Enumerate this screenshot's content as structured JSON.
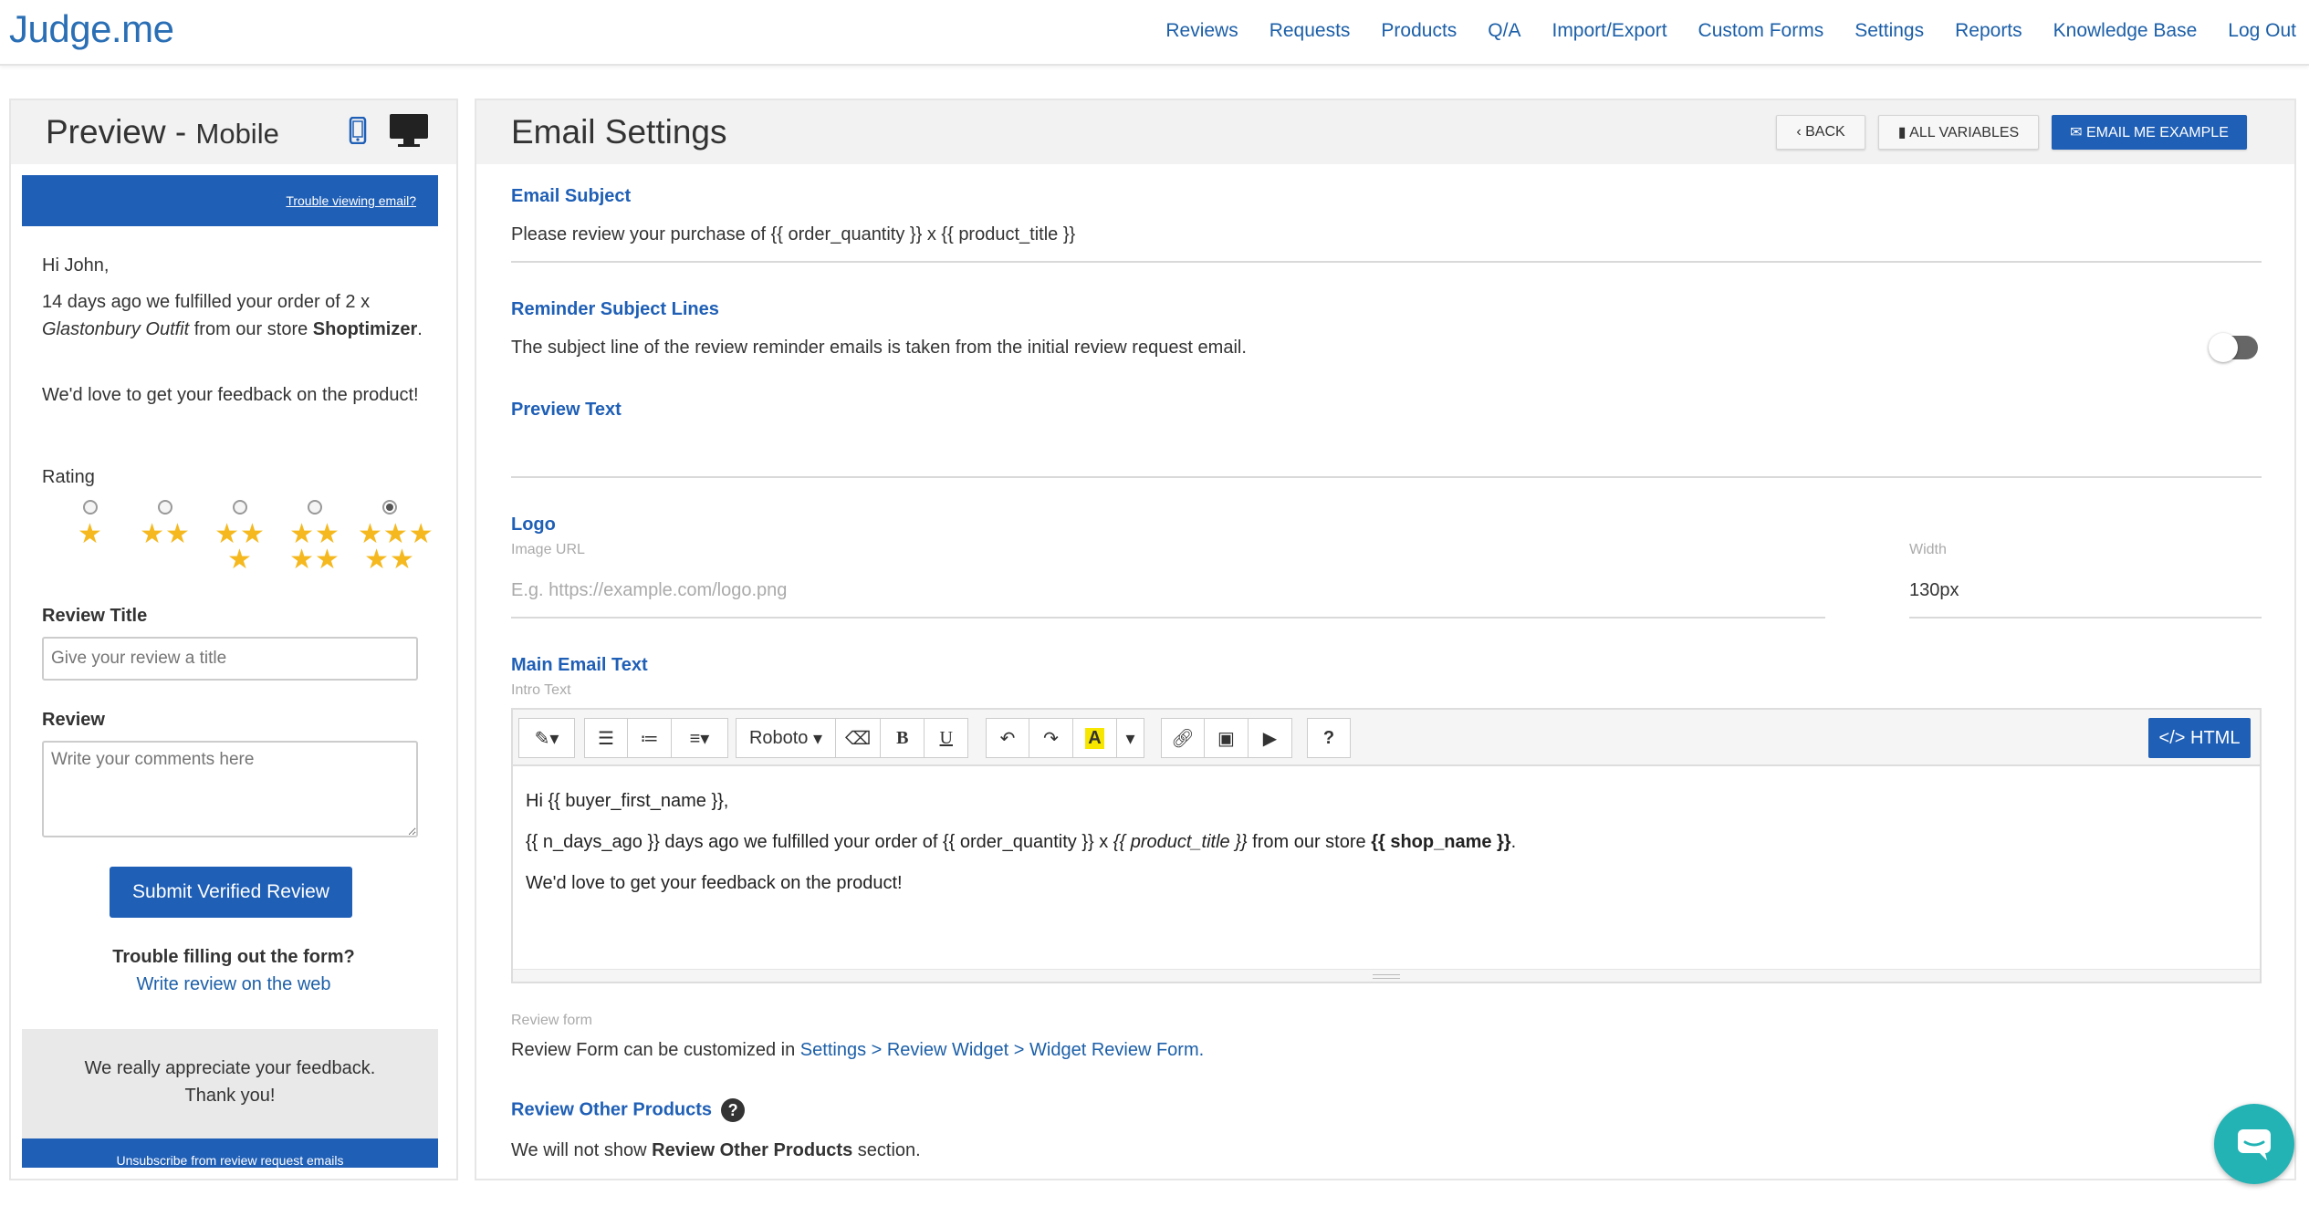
{
  "nav": {
    "logo": "Judge.me",
    "links": [
      "Reviews",
      "Requests",
      "Products",
      "Q/A",
      "Import/Export",
      "Custom Forms",
      "Settings",
      "Reports",
      "Knowledge Base",
      "Log Out"
    ]
  },
  "preview": {
    "title": "Preview",
    "separator": " - ",
    "mode": "Mobile",
    "trouble_viewing": "Trouble viewing email?",
    "greeting": "Hi John,",
    "p1_prefix": "14 days ago we fulfilled your order of 2 x ",
    "p1_product": "Glastonbury Outfit",
    "p1_mid": " from our store ",
    "p1_store": "Shoptimizer",
    "p1_suffix": ".",
    "p2": "We'd love to get your feedback on the product!",
    "rating_label": "Rating",
    "rating_selected": 5,
    "review_title_label": "Review Title",
    "review_title_placeholder": "Give your review a title",
    "review_label": "Review",
    "review_placeholder": "Write your comments here",
    "submit_label": "Submit Verified Review",
    "trouble_form": "Trouble filling out the form?",
    "write_web": "Write review on the web",
    "thanks_line1": "We really appreciate your feedback.",
    "thanks_line2": "Thank you!",
    "unsubscribe": "Unsubscribe from review request emails"
  },
  "settings": {
    "title": "Email Settings",
    "back_label": "BACK",
    "vars_label": "ALL VARIABLES",
    "example_label": "EMAIL ME EXAMPLE",
    "email_subject_title": "Email Subject",
    "email_subject_value": "Please review your purchase of {{ order_quantity }} x {{ product_title }}",
    "reminder_title": "Reminder Subject Lines",
    "reminder_text": "The subject line of the review reminder emails is taken from the initial review request email.",
    "reminder_toggle_on": false,
    "preview_text_title": "Preview Text",
    "preview_text_value": "",
    "logo_title": "Logo",
    "image_url_label": "Image URL",
    "image_url_placeholder": "E.g. https://example.com/logo.png",
    "width_label": "Width",
    "width_value": "130px",
    "main_text_title": "Main Email Text",
    "intro_label": "Intro Text",
    "font_label": "Roboto",
    "html_label": "HTML",
    "editor_line1": "Hi {{ buyer_first_name }},",
    "editor_line2_a": "{{ n_days_ago }} days ago we fulfilled your order of {{ order_quantity }} x ",
    "editor_line2_b": "{{ product_title }}",
    "editor_line2_c": " from our store ",
    "editor_line2_d": "{{ shop_name }}",
    "editor_line2_e": ".",
    "editor_line3": "We'd love to get your feedback on the product!",
    "review_form_label": "Review form",
    "review_form_prefix": "Review Form can be customized in ",
    "review_form_link": "Settings > Review Widget > Widget Review Form.",
    "other_products_title": "Review Other Products",
    "other_products_help": "?",
    "other_products_prefix": "We will not show ",
    "other_products_bold": "Review Other Products",
    "other_products_suffix": " section."
  },
  "colors": {
    "brand_blue": "#1f5fb6",
    "star": "#f5b91f",
    "chat": "#23b3b5"
  },
  "icons": [
    "mobile-icon",
    "desktop-icon",
    "chevron-left-icon",
    "book-icon",
    "envelope-icon",
    "magic-icon",
    "ordered-list-icon",
    "unordered-list-icon",
    "align-icon",
    "eraser-icon",
    "bold-icon",
    "underline-icon",
    "undo-icon",
    "redo-icon",
    "font-color-icon",
    "link-icon",
    "image-icon",
    "video-icon",
    "help-icon",
    "code-icon",
    "chat-icon"
  ]
}
